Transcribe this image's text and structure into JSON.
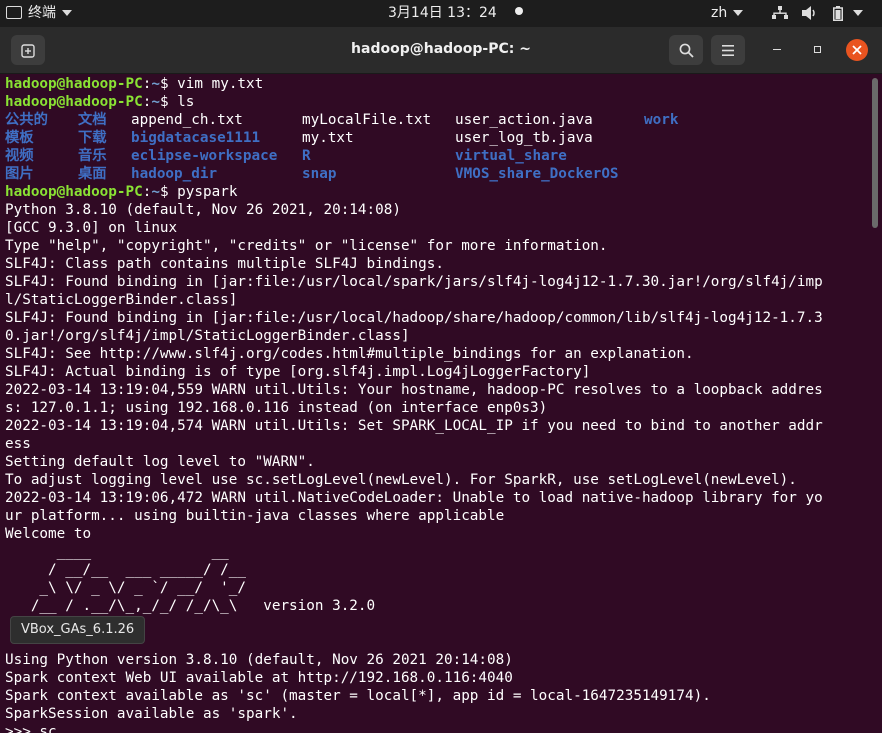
{
  "topbar": {
    "app_menu": "终端",
    "clock": "3月14日 13：24",
    "lang": "zh"
  },
  "window": {
    "title": "hadoop@hadoop-PC: ~"
  },
  "prompt": {
    "user": "hadoop@hadoop-PC",
    "sep": ":",
    "path": "~",
    "dollar": "$ "
  },
  "commands": {
    "vim": "vim my.txt",
    "ls": "ls",
    "pyspark": "pyspark"
  },
  "ls_rows": [
    [
      "公共的",
      "文档",
      "append_ch.txt",
      "myLocalFile.txt",
      "user_action.java",
      "work"
    ],
    [
      "模板",
      "下载",
      "bigdatacase1111",
      "my.txt",
      "user_log_tb.java",
      ""
    ],
    [
      "视频",
      "音乐",
      "eclipse-workspace",
      "R",
      "virtual_share",
      ""
    ],
    [
      "图片",
      "桌面",
      "hadoop_dir",
      "snap",
      "VMOS_share_DockerOS",
      ""
    ]
  ],
  "output_lines": [
    "Python 3.8.10 (default, Nov 26 2021, 20:14:08)",
    "[GCC 9.3.0] on linux",
    "Type \"help\", \"copyright\", \"credits\" or \"license\" for more information.",
    "SLF4J: Class path contains multiple SLF4J bindings.",
    "SLF4J: Found binding in [jar:file:/usr/local/spark/jars/slf4j-log4j12-1.7.30.jar!/org/slf4j/imp",
    "l/StaticLoggerBinder.class]",
    "SLF4J: Found binding in [jar:file:/usr/local/hadoop/share/hadoop/common/lib/slf4j-log4j12-1.7.3",
    "0.jar!/org/slf4j/impl/StaticLoggerBinder.class]",
    "SLF4J: See http://www.slf4j.org/codes.html#multiple_bindings for an explanation.",
    "SLF4J: Actual binding is of type [org.slf4j.impl.Log4jLoggerFactory]",
    "2022-03-14 13:19:04,559 WARN util.Utils: Your hostname, hadoop-PC resolves to a loopback addres",
    "s: 127.0.1.1; using 192.168.0.116 instead (on interface enp0s3)",
    "2022-03-14 13:19:04,574 WARN util.Utils: Set SPARK_LOCAL_IP if you need to bind to another addr",
    "ess",
    "Setting default log level to \"WARN\".",
    "To adjust logging level use sc.setLogLevel(newLevel). For SparkR, use setLogLevel(newLevel).",
    "2022-03-14 13:19:06,472 WARN util.NativeCodeLoader: Unable to load native-hadoop library for yo",
    "ur platform... using builtin-java classes where applicable",
    "Welcome to",
    "      ____              __",
    "     / __/__  ___ _____/ /__",
    "    _\\ \\/ _ \\/ _ `/ __/  '_/",
    "   /__ / .__/\\_,_/_/ /_/\\_\\   version 3.2.0",
    "      /_/",
    "",
    "Using Python version 3.8.10 (default, Nov 26 2021 20:14:08)",
    "Spark context Web UI available at http://192.168.0.116:4040",
    "Spark context available as 'sc' (master = local[*], app id = local-1647235149174).",
    "SparkSession available as 'spark'.",
    ">>> sc"
  ],
  "tooltip": "VBox_GAs_6.1.26"
}
